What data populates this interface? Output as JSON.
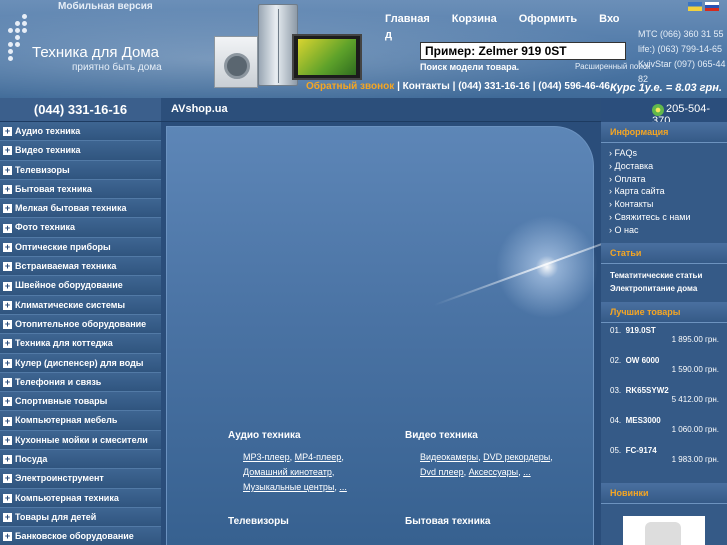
{
  "header": {
    "mobile_link": "Мобильная версия",
    "site_title": "Техника для Дома",
    "tagline": "приятно быть дома",
    "nav": [
      "Главная",
      "Корзина",
      "Оформить",
      "Вхо"
    ],
    "nav_tail": "д",
    "phones": [
      "МТС  (066) 360 31 55",
      "life:)  (063) 799-14-65",
      "KyivStar  (097) 065-44 82"
    ],
    "search_value": "Пример: Zelmer 919 0ST",
    "search_hint": "Поиск модели товара.",
    "advanced_search": "Расширенный поиск",
    "callback": "Обратный звонок",
    "contacts": "Контакты",
    "phone1": "(044) 331-16-16",
    "phone2": "(044) 596-46-46",
    "sep": "|",
    "rate": "Курс 1у.е. = 8.03 грн."
  },
  "left": {
    "phone": "(044) 331-16-16",
    "items": [
      "Аудио техника",
      "Видео техника",
      "Телевизоры",
      "Бытовая техника",
      "Мелкая бытовая техника",
      "Фото техника",
      "Оптические приборы",
      "Встраиваемая техника",
      "Швейное оборудование",
      "Климатические системы",
      "Отопительное оборудование",
      "Техника для коттеджа",
      "Кулер (диспенсер) для воды",
      "Телефония и связь",
      "Спортивные товары",
      "Компьютерная мебель",
      "Кухонные мойки и смесители",
      "Посуда",
      "Электроинструмент",
      "Компьютерная техника",
      "Товары для детей",
      "Банковское оборудование"
    ],
    "plus": "+"
  },
  "center": {
    "site_name": "AVshop.ua",
    "right_phone": "205-504-370",
    "audio_title": "Аудио техника",
    "audio_links": [
      "МР3-плеер",
      "МР4-плеер",
      "Домашний кинотеатр",
      "Музыкальные центры",
      "..."
    ],
    "video_title": "Видео техника",
    "video_links": [
      "Видеокамеры",
      "DVD рекордеры",
      "Dvd плеер",
      "Аксессуары",
      "..."
    ],
    "tv_title": "Телевизоры",
    "appliance_title": "Бытовая техника",
    "comma": ", "
  },
  "right": {
    "info_title": "Информация",
    "info_items": [
      "FAQs",
      "Доставка",
      "Оплата",
      "Карта сайта",
      "Контакты",
      "Свяжитесь с нами",
      "О нас"
    ],
    "articles_title": "Статьи",
    "articles": [
      "Тематитические статьи",
      "Электропитание дома"
    ],
    "best_title": "Лучшие товары",
    "best": [
      {
        "no": "01.",
        "name": "919.0ST",
        "price": "1 895.00 грн."
      },
      {
        "no": "02.",
        "name": "OW 6000",
        "price": "1 590.00 грн."
      },
      {
        "no": "03.",
        "name": "RK65SYW2",
        "price": "5 412.00 грн."
      },
      {
        "no": "04.",
        "name": "MES3000",
        "price": "1 060.00 грн."
      },
      {
        "no": "05.",
        "name": "FC-9174",
        "price": "1 983.00 грн."
      }
    ],
    "new_title": "Новинки"
  }
}
